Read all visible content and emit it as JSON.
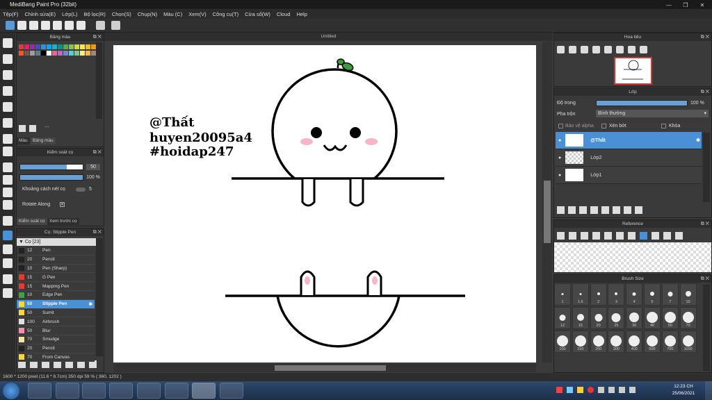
{
  "window": {
    "title": "MediBang Paint Pro (32bit)"
  },
  "menu": [
    "Tệp(F)",
    "Chỉnh sửa(E)",
    "Lớp(L)",
    "Bộ lọc(R)",
    "Chọn(S)",
    "Chụp(N)",
    "Màu (C)",
    "Xem(V)",
    "Công cụ(T)",
    "Cửa sổ(W)",
    "Cloud",
    "Help"
  ],
  "colors": {
    "accent": "#6a9fd4",
    "selection": "#4a90d6"
  },
  "palette": {
    "title": "Bảng màu",
    "swatches": [
      "#e53935",
      "#e91e63",
      "#9c27b0",
      "#3f51b5",
      "#2196f3",
      "#03a9f4",
      "#00bcd4",
      "#009688",
      "#4caf50",
      "#8bc34a",
      "#cddc39",
      "#ffeb3b",
      "#ffc107",
      "#ff9800",
      "#ff5722",
      "#795548",
      "#9e9e9e",
      "#607d8b",
      "#000000",
      "#ffffff",
      "#f06292",
      "#ba68c8",
      "#7986cb",
      "#4dd0e1",
      "#81c784",
      "#fff176",
      "#ffb74d",
      "#a1887f"
    ],
    "tabs": [
      "Màu",
      "Bảng màu"
    ],
    "dash": "---"
  },
  "brush_control": {
    "title": "Kiểm soát cọ",
    "size_value": "50",
    "opacity_value": "100 %",
    "spacing_label": "Khoảng cách nét cọ",
    "spacing_value": "5",
    "rotate_label": "Rotate Along",
    "tabs": [
      "Kiểm soát cọ",
      "Xem trước cọ"
    ]
  },
  "brush_list": {
    "title": "Cọ: Stipple Pen",
    "group": "Cọ [23]",
    "items": [
      {
        "size": "12",
        "name": "Pen",
        "color": "#222222"
      },
      {
        "size": "20",
        "name": "Pencil",
        "color": "#222222"
      },
      {
        "size": "10",
        "name": "Pen (Sharp)",
        "color": "#222222"
      },
      {
        "size": "15",
        "name": "G Pen",
        "color": "#e53935"
      },
      {
        "size": "15",
        "name": "Mapping Pen",
        "color": "#e53935"
      },
      {
        "size": "10",
        "name": "Edge Pen",
        "color": "#43a047"
      },
      {
        "size": "50",
        "name": "Stipple Pen",
        "color": "#fdd835"
      },
      {
        "size": "50",
        "name": "Sumit",
        "color": "#fdd835"
      },
      {
        "size": "100",
        "name": "Airbrush",
        "color": "#e0e0e0"
      },
      {
        "size": "50",
        "name": "Blur",
        "color": "#f48fb1"
      },
      {
        "size": "70",
        "name": "Smudge",
        "color": "#f5e6a0"
      },
      {
        "size": "20",
        "name": "Pencil",
        "color": "#222222"
      },
      {
        "size": "70",
        "name": "From Canvas",
        "color": "#fdd835"
      }
    ],
    "selected_index": 6
  },
  "canvas": {
    "tab": "Untitled",
    "text_lines": [
      "@Thất",
      "huyen20095a4",
      "#hoidap247"
    ]
  },
  "navigator": {
    "title": "Hoa tiêu"
  },
  "layers": {
    "title": "Lớp",
    "opacity_label": "Độ trong",
    "opacity_value": "100 %",
    "opacity_fraction": 1.0,
    "blend_label": "Pha trộn",
    "blend_value": "Bình thường",
    "alpha_label": "Bảo vệ alpha",
    "clip_label": "Xén bớt",
    "lock_label": "Khóa",
    "items": [
      {
        "name": "@Thất",
        "selected": true
      },
      {
        "name": "Lớp2",
        "selected": false
      },
      {
        "name": "Lớp1",
        "selected": false
      }
    ]
  },
  "reference": {
    "title": "Reference"
  },
  "brush_size": {
    "title": "Brush Size",
    "row1": [
      "1",
      "1.5",
      "2",
      "3",
      "4",
      "5",
      "7",
      "10"
    ],
    "row2": [
      "12",
      "15",
      "20",
      "25",
      "30",
      "40",
      "50",
      "70"
    ],
    "row3": [
      "100",
      "150",
      "200",
      "300",
      "400",
      "500",
      "700",
      "1000"
    ]
  },
  "status": {
    "text": "1600 * 1200 pixel   (11.6 * 8.7cm)   350 dpi   59 %   ( 360, 1202 )"
  },
  "taskbar": {
    "time": "12:23 CH",
    "date": "25/06/2021"
  }
}
